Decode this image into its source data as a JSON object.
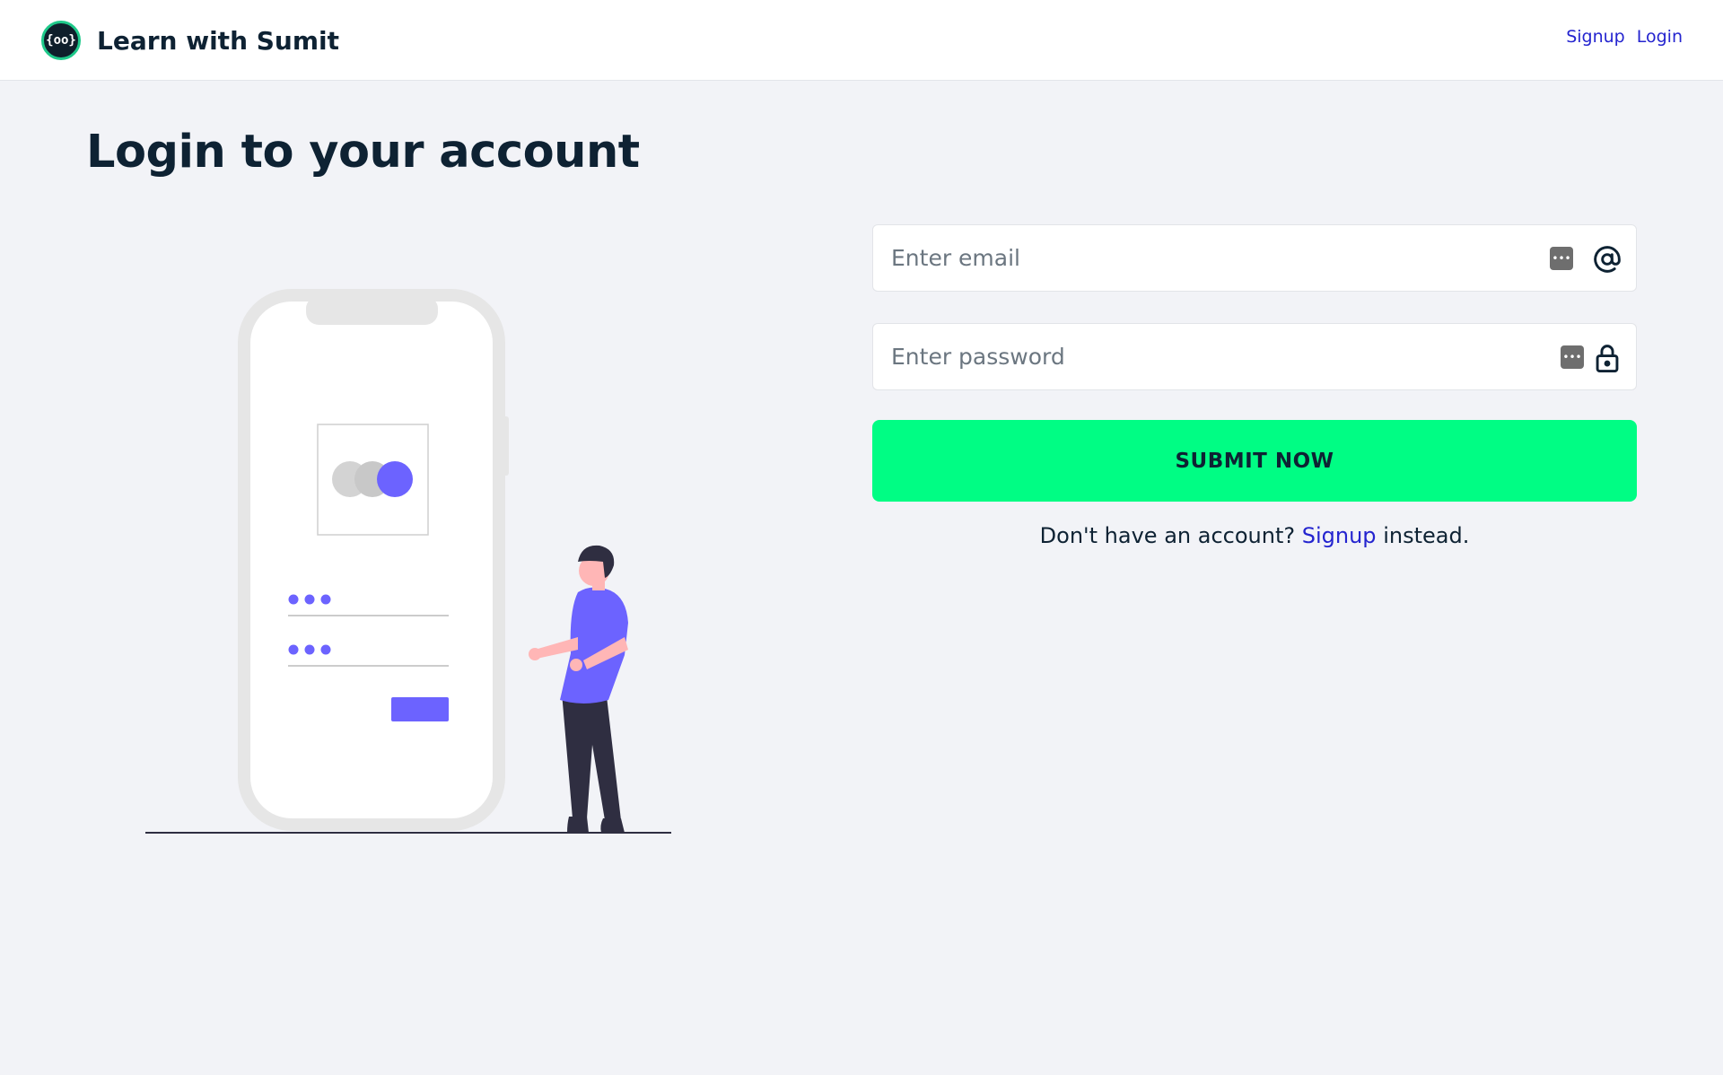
{
  "header": {
    "logo_text": "{oo}",
    "brand_name": "Learn with Sumit",
    "nav": [
      {
        "label": "Signup"
      },
      {
        "label": "Login"
      }
    ]
  },
  "page": {
    "title": "Login to your account"
  },
  "form": {
    "email": {
      "placeholder": "Enter email",
      "value": "",
      "icon": "at-icon"
    },
    "password": {
      "placeholder": "Enter password",
      "value": "",
      "icon": "lock-icon"
    },
    "password_manager_icon": "•••",
    "submit_label": "SUBMIT NOW",
    "signup_prompt": "Don't have an account?",
    "signup_link": "Signup",
    "signup_suffix": "instead."
  },
  "colors": {
    "accent": "#00fd84",
    "link": "#2424cf",
    "illustration_primary": "#6c63ff",
    "text": "#0e2233"
  }
}
